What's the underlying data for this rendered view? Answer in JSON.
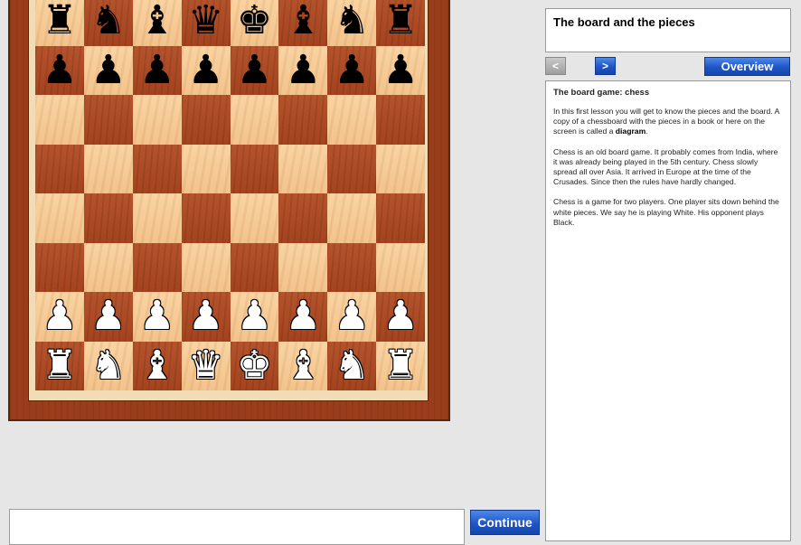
{
  "board": {
    "rows": [
      [
        "r",
        "n",
        "b",
        "q",
        "k",
        "b",
        "n",
        "r"
      ],
      [
        "p",
        "p",
        "p",
        "p",
        "p",
        "p",
        "p",
        "p"
      ],
      [
        "",
        "",
        "",
        "",
        "",
        "",
        "",
        ""
      ],
      [
        "",
        "",
        "",
        "",
        "",
        "",
        "",
        ""
      ],
      [
        "",
        "",
        "",
        "",
        "",
        "",
        "",
        ""
      ],
      [
        "",
        "",
        "",
        "",
        "",
        "",
        "",
        ""
      ],
      [
        "P",
        "P",
        "P",
        "P",
        "P",
        "P",
        "P",
        "P"
      ],
      [
        "R",
        "N",
        "B",
        "Q",
        "K",
        "B",
        "N",
        "R"
      ]
    ],
    "light_color": "#f4c790",
    "dark_color": "#a8451f",
    "frame_color": "#9a3d1a"
  },
  "lesson": {
    "title": "The board and the pieces",
    "heading": "The board game: chess",
    "paragraph1_before": "In this first lesson you will get to know the pieces and the board. A copy of a chessboard with the pieces in a book or here on the screen is called a ",
    "paragraph1_bold": "diagram",
    "paragraph1_after": ".",
    "paragraph2": "Chess is an old board game. It probably comes from India, where it was already being played in the 5th century. Chess slowly spread all over Asia. It arrived in Europe at the time of the Crusades. Since then the rules have hardly changed.",
    "paragraph3": "Chess is a game for two players. One player sits down behind the white pieces. We say he is playing White. His opponent plays Black."
  },
  "nav": {
    "prev_label": "<",
    "next_label": ">",
    "overview_label": "Overview"
  },
  "bottom": {
    "message_text": "",
    "continue_label": "Continue"
  },
  "colors": {
    "button_blue": "#1f55c6",
    "button_gray": "#a8a8a8"
  }
}
